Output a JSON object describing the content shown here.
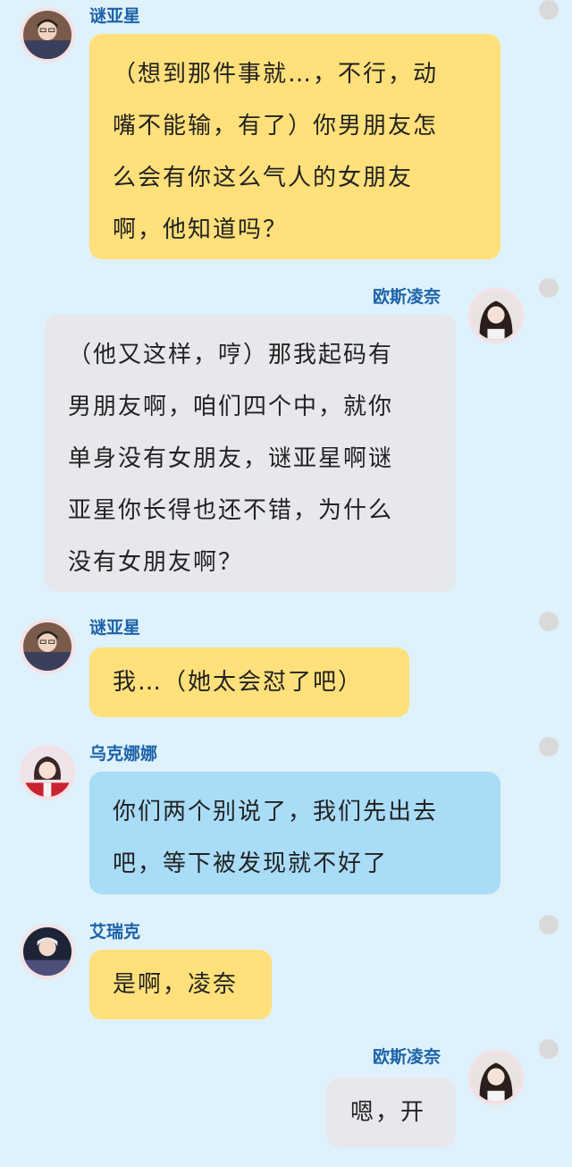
{
  "colors": {
    "background": "#dff1fb",
    "name": "#1b62a8",
    "bubble_yellow": "#ffe07a",
    "bubble_gray": "#e6e8ec",
    "bubble_blue": "#a9dcf7"
  },
  "messages": [
    {
      "sender": "谜亚星",
      "lines": [
        "（想到那件事就…，不行，动",
        "嘴不能输，有了）你男朋友怎",
        "么会有你这么气人的女朋友",
        "啊，他知道吗？"
      ]
    },
    {
      "sender": "欧斯凌奈",
      "lines": [
        "（他又这样，哼）那我起码有",
        "男朋友啊，咱们四个中，就你",
        "单身没有女朋友，谜亚星啊谜",
        "亚星你长得也还不错，为什么",
        "没有女朋友啊？"
      ]
    },
    {
      "sender": "谜亚星",
      "lines": [
        "我…（她太会怼了吧）"
      ]
    },
    {
      "sender": "乌克娜娜",
      "lines": [
        "你们两个别说了，我们先出去",
        "吧，等下被发现就不好了"
      ]
    },
    {
      "sender": "艾瑞克",
      "lines": [
        "是啊，凌奈"
      ]
    },
    {
      "sender": "欧斯凌奈",
      "lines": [
        "嗯，开"
      ]
    }
  ]
}
